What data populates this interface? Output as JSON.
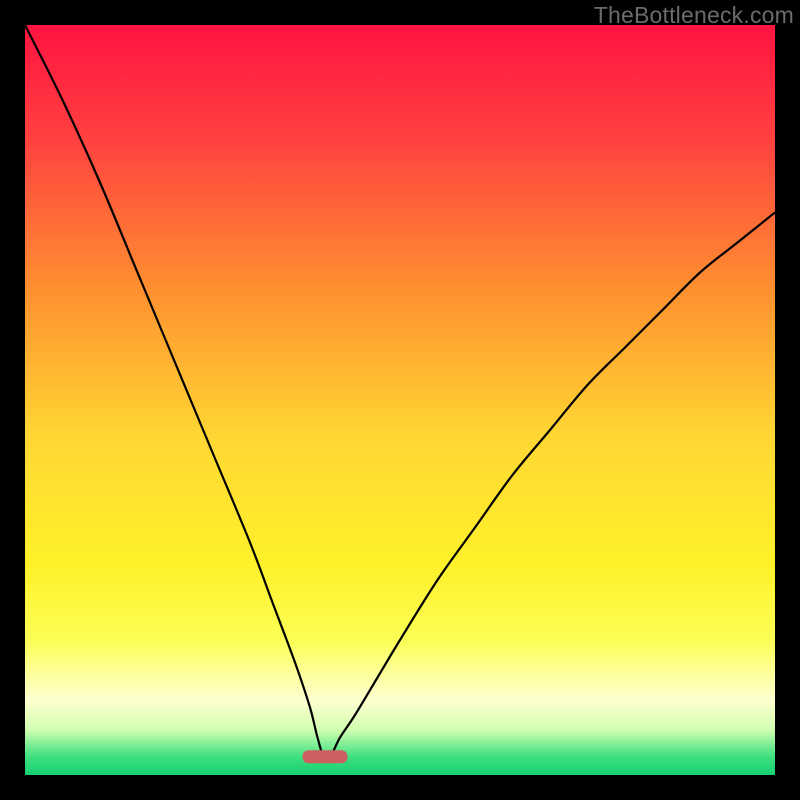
{
  "watermark": "TheBottleneck.com",
  "colors": {
    "frame": "#000000",
    "curve": "#000000",
    "pill": "#cd5f62",
    "gradient_stops": [
      {
        "offset": 0.0,
        "color": "#ff1440"
      },
      {
        "offset": 0.15,
        "color": "#ff4040"
      },
      {
        "offset": 0.35,
        "color": "#ff8f30"
      },
      {
        "offset": 0.55,
        "color": "#ffd733"
      },
      {
        "offset": 0.72,
        "color": "#fff12a"
      },
      {
        "offset": 0.82,
        "color": "#fbff55"
      },
      {
        "offset": 0.9,
        "color": "#ffffd0"
      },
      {
        "offset": 0.94,
        "color": "#d0ffb0"
      },
      {
        "offset": 0.975,
        "color": "#40e080"
      },
      {
        "offset": 1.0,
        "color": "#15d070"
      }
    ]
  },
  "chart_data": {
    "type": "line",
    "title": "",
    "xlabel": "",
    "ylabel": "",
    "xlim": [
      0,
      100
    ],
    "ylim": [
      0,
      100
    ],
    "optimum_x": 40,
    "pill": {
      "x_center": 40,
      "width": 6,
      "y": 2.5
    },
    "series": [
      {
        "name": "bottleneck-curve",
        "x": [
          0,
          5,
          10,
          15,
          20,
          25,
          30,
          33,
          36,
          38,
          39,
          40,
          41,
          42,
          44,
          47,
          50,
          55,
          60,
          65,
          70,
          75,
          80,
          85,
          90,
          95,
          100
        ],
        "y": [
          100,
          90,
          79,
          67,
          55,
          43,
          31,
          23,
          15,
          9,
          5,
          2,
          3,
          5,
          8,
          13,
          18,
          26,
          33,
          40,
          46,
          52,
          57,
          62,
          67,
          71,
          75
        ]
      }
    ]
  }
}
